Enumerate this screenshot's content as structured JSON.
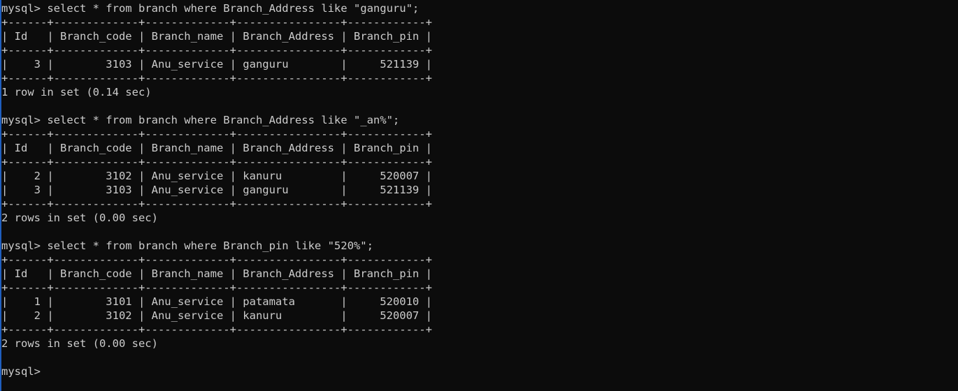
{
  "terminal": {
    "lines": [
      "mysql> select * from branch where Branch_Address like \"ganguru\";",
      "+------+-------------+-------------+----------------+------------+",
      "| Id   | Branch_code | Branch_name | Branch_Address | Branch_pin |",
      "+------+-------------+-------------+----------------+------------+",
      "|    3 |        3103 | Anu_service | ganguru        |     521139 |",
      "+------+-------------+-------------+----------------+------------+",
      "1 row in set (0.14 sec)",
      "",
      "mysql> select * from branch where Branch_Address like \"_an%\";",
      "+------+-------------+-------------+----------------+------------+",
      "| Id   | Branch_code | Branch_name | Branch_Address | Branch_pin |",
      "+------+-------------+-------------+----------------+------------+",
      "|    2 |        3102 | Anu_service | kanuru         |     520007 |",
      "|    3 |        3103 | Anu_service | ganguru        |     521139 |",
      "+------+-------------+-------------+----------------+------------+",
      "2 rows in set (0.00 sec)",
      "",
      "mysql> select * from branch where Branch_pin like \"520%\";",
      "+------+-------------+-------------+----------------+------------+",
      "| Id   | Branch_code | Branch_name | Branch_Address | Branch_pin |",
      "+------+-------------+-------------+----------------+------------+",
      "|    1 |        3101 | Anu_service | patamata       |     520010 |",
      "|    2 |        3102 | Anu_service | kanuru         |     520007 |",
      "+------+-------------+-------------+----------------+------------+",
      "2 rows in set (0.00 sec)",
      "",
      "mysql>"
    ]
  },
  "colors": {
    "background": "#0c0c0c",
    "text": "#cccccc",
    "edge": "#1f5fbf"
  }
}
